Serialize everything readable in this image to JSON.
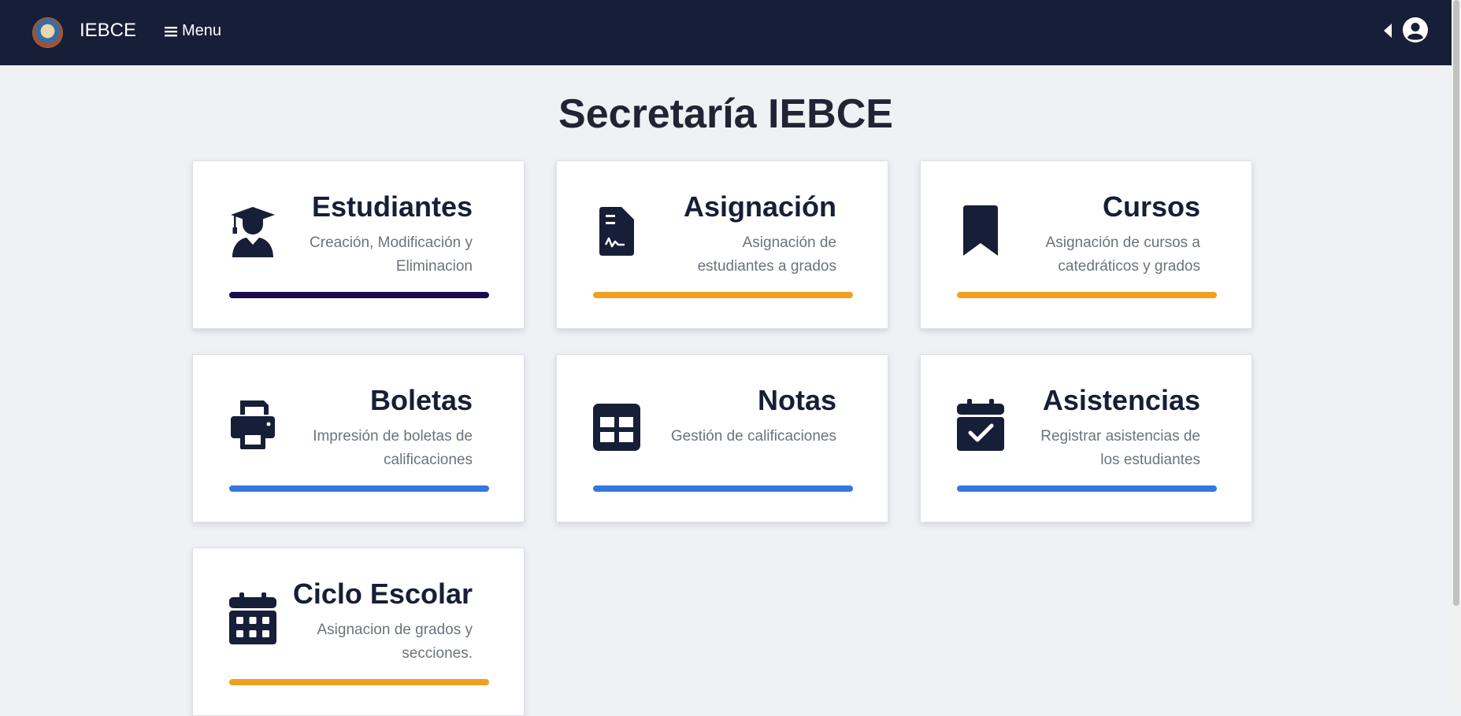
{
  "navbar": {
    "brand": "IEBCE",
    "menu_label": "Menu",
    "icons": {
      "menu": "hamburger-icon",
      "caret": "caret-left-icon",
      "user": "user-circle-icon"
    }
  },
  "page": {
    "title": "Secretaría IEBCE"
  },
  "colors": {
    "navbar": "#171e37",
    "bar_dark": "#1a0b4b",
    "bar_orange": "#f0a020",
    "bar_blue": "#3478e0"
  },
  "cards": [
    {
      "title": "Estudiantes",
      "description": "Creación, Modificación y Eliminacion",
      "icon": "graduate-icon",
      "bar_color": "#1a0b4b"
    },
    {
      "title": "Asignación",
      "description": "Asignación de estudiantes a grados",
      "icon": "file-signature-icon",
      "bar_color": "#f0a020"
    },
    {
      "title": "Cursos",
      "description": "Asignación de cursos a catedráticos y grados",
      "icon": "bookmark-icon",
      "bar_color": "#f0a020"
    },
    {
      "title": "Boletas",
      "description": "Impresión de boletas de calificaciones",
      "icon": "printer-icon",
      "bar_color": "#3478e0"
    },
    {
      "title": "Notas",
      "description": "Gestión de calificaciones",
      "icon": "grid-table-icon",
      "bar_color": "#3478e0"
    },
    {
      "title": "Asistencias",
      "description": "Registrar asistencias de los estudiantes",
      "icon": "calendar-check-icon",
      "bar_color": "#3478e0"
    },
    {
      "title": "Ciclo Escolar",
      "description": "Asignacion de grados y secciones.",
      "icon": "calendar-days-icon",
      "bar_color": "#f0a020"
    }
  ]
}
